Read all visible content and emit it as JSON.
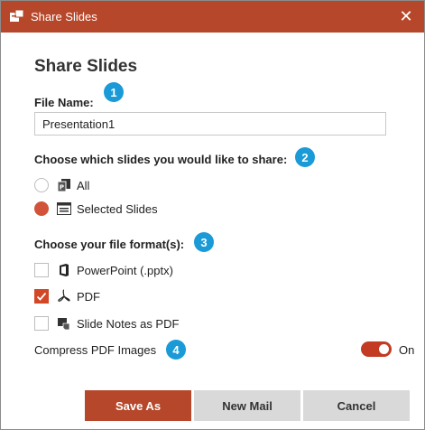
{
  "window": {
    "title": "Share Slides",
    "close_glyph": "✕",
    "accent": "#b7472a",
    "badge_color": "#1a9ad6"
  },
  "heading": "Share Slides",
  "file_name": {
    "label": "File Name:",
    "value": "Presentation1",
    "badge": "1"
  },
  "slides_choice": {
    "label": "Choose which slides you would like to share:",
    "badge": "2",
    "options": [
      {
        "label": "All",
        "icon": "powerpoint-slides-icon",
        "selected": false
      },
      {
        "label": "Selected Slides",
        "icon": "selected-slide-icon",
        "selected": true
      }
    ]
  },
  "format_choice": {
    "label": "Choose your file format(s):",
    "badge": "3",
    "options": [
      {
        "label": "PowerPoint (.pptx)",
        "icon": "office-icon",
        "checked": false
      },
      {
        "label": "PDF",
        "icon": "pdf-icon",
        "checked": true
      },
      {
        "label": "Slide Notes as PDF",
        "icon": "slide-notes-icon",
        "checked": false
      }
    ]
  },
  "compress": {
    "label": "Compress PDF Images",
    "badge": "4",
    "state_text": "On",
    "enabled": true
  },
  "buttons": {
    "save_as": "Save As",
    "new_mail": "New Mail",
    "cancel": "Cancel"
  }
}
